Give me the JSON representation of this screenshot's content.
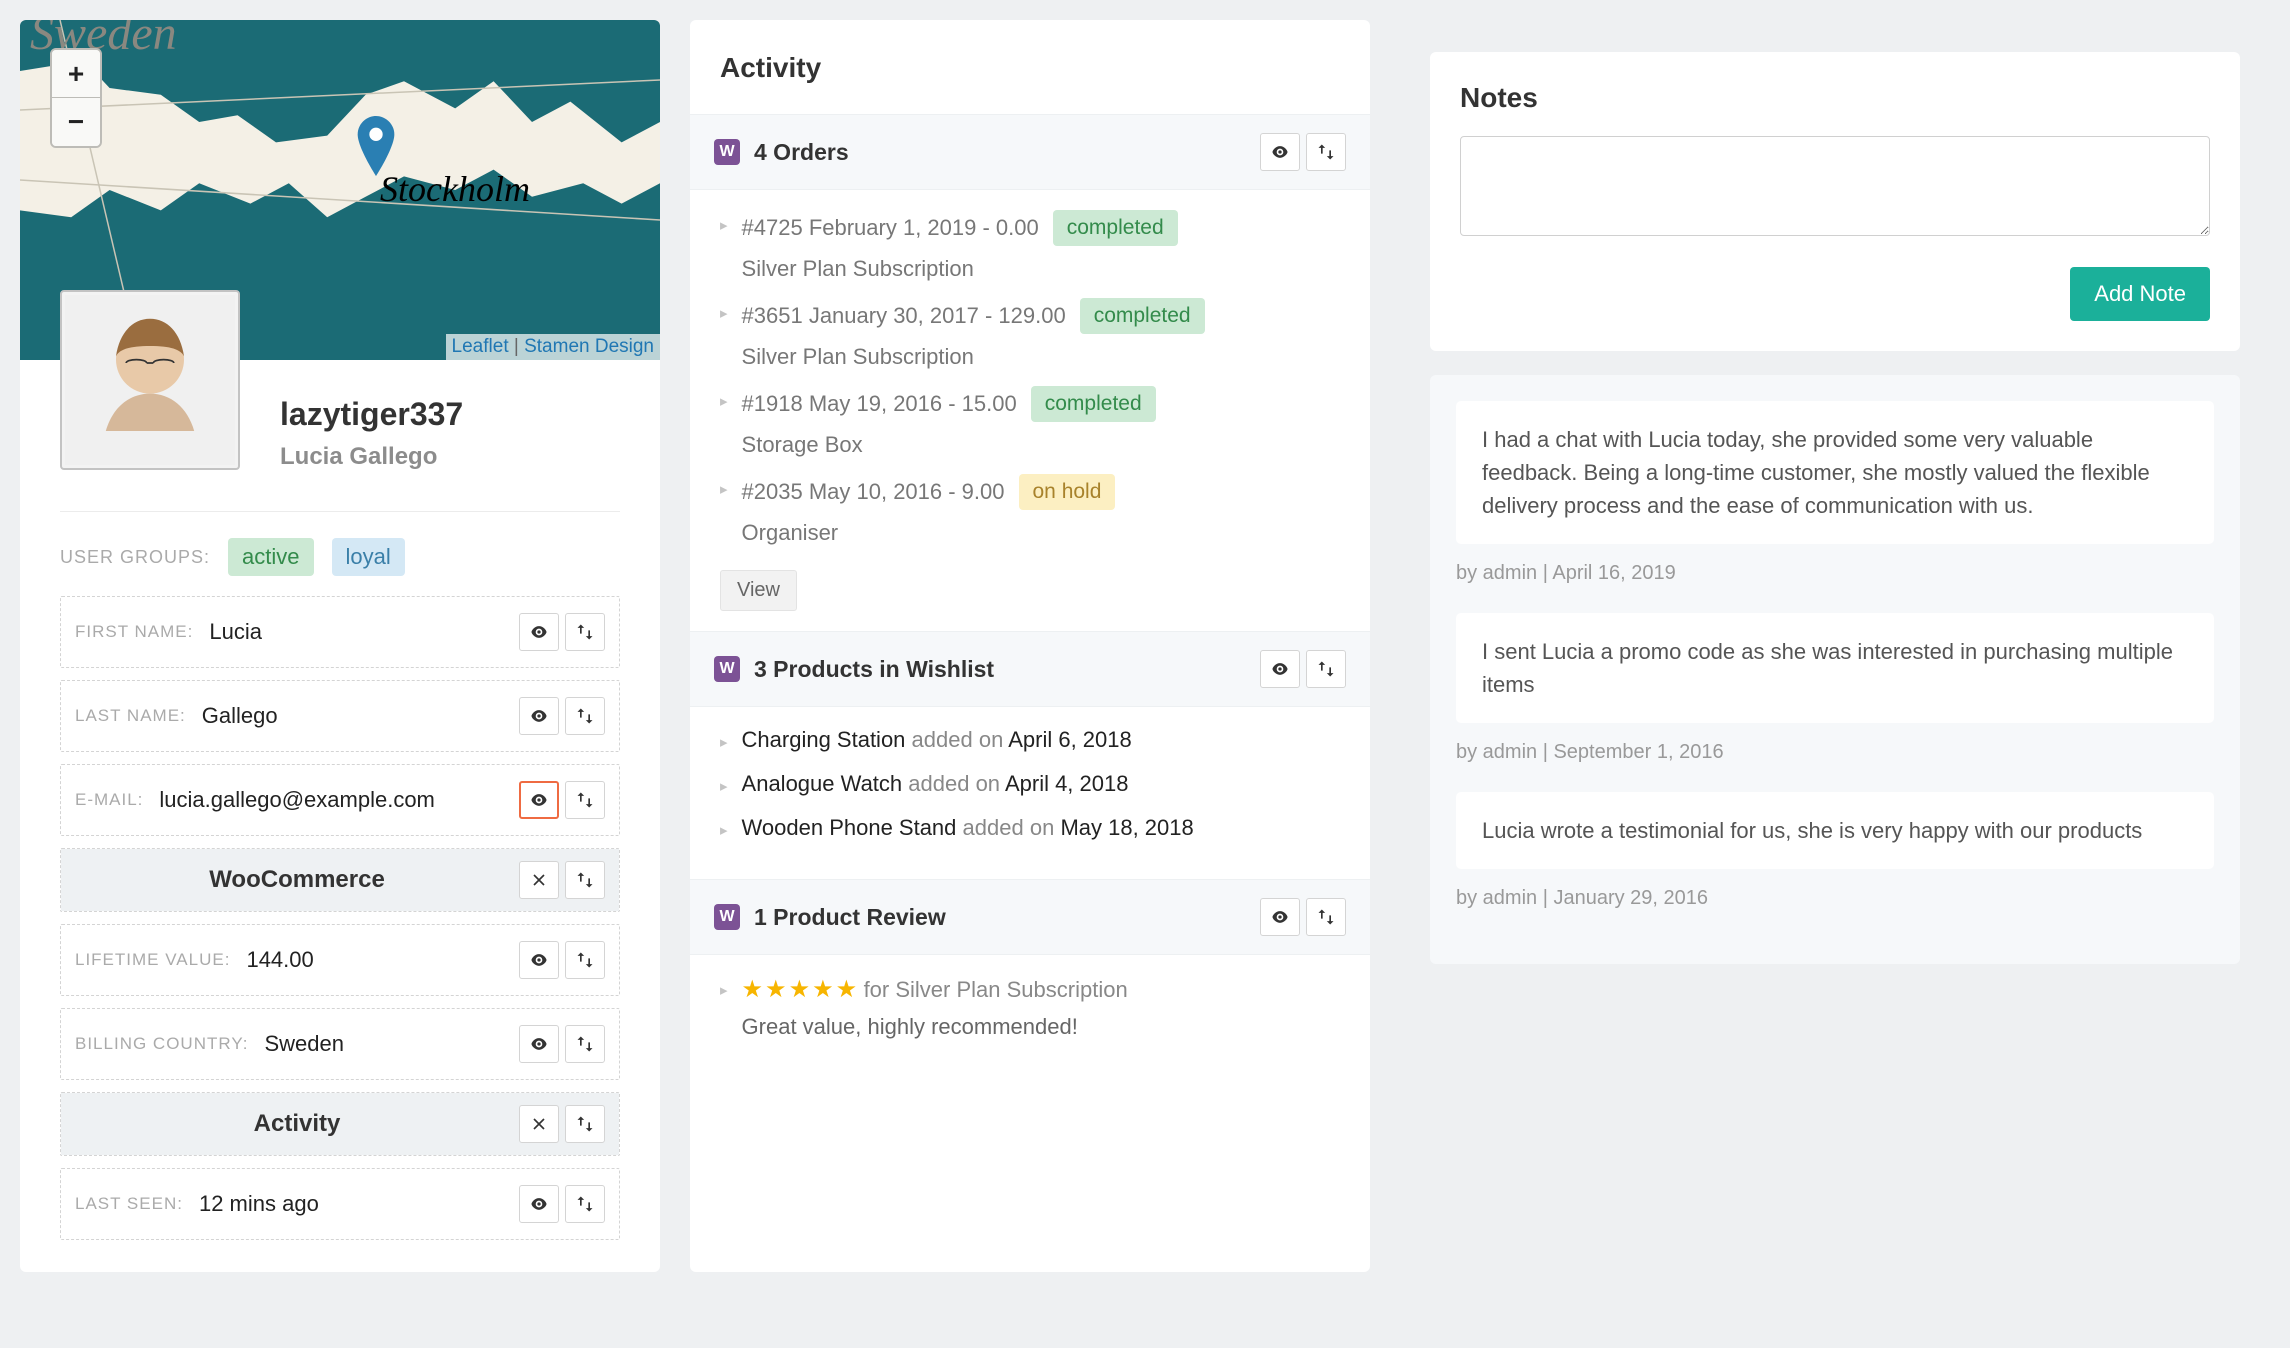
{
  "profile": {
    "map": {
      "country_label": "Sweden",
      "city_label": "Stockholm",
      "zoom_in": "+",
      "zoom_out": "−",
      "attr_leaflet": "Leaflet",
      "attr_sep": " | ",
      "attr_stamen": "Stamen Design"
    },
    "username": "lazytiger337",
    "full_name": "Lucia Gallego",
    "groups_label": "USER GROUPS:",
    "groups": [
      {
        "name": "active",
        "style": "green"
      },
      {
        "name": "loyal",
        "style": "blue"
      }
    ],
    "fields": {
      "first_name": {
        "label": "FIRST NAME:",
        "value": "Lucia"
      },
      "last_name": {
        "label": "LAST NAME:",
        "value": "Gallego"
      },
      "email": {
        "label": "E-MAIL:",
        "value": "lucia.gallego@example.com"
      },
      "lifetime_value": {
        "label": "LIFETIME VALUE:",
        "value": "144.00"
      },
      "billing_country": {
        "label": "BILLING COUNTRY:",
        "value": "Sweden"
      },
      "last_seen": {
        "label": "LAST SEEN:",
        "value": "12 mins ago"
      }
    },
    "sections": {
      "woocommerce": "WooCommerce",
      "activity": "Activity"
    }
  },
  "activity": {
    "heading": "Activity",
    "groups": {
      "orders": {
        "title": "4 Orders",
        "items": [
          {
            "id": "#4725",
            "date": "February 1, 2019",
            "amount": "0.00",
            "status": "completed",
            "status_style": "complete",
            "desc": "Silver Plan Subscription"
          },
          {
            "id": "#3651",
            "date": "January 30, 2017",
            "amount": "129.00",
            "status": "completed",
            "status_style": "complete",
            "desc": "Silver Plan Subscription"
          },
          {
            "id": "#1918",
            "date": "May 19, 2016",
            "amount": "15.00",
            "status": "completed",
            "status_style": "complete",
            "desc": "Storage Box"
          },
          {
            "id": "#2035",
            "date": "May 10, 2016",
            "amount": "9.00",
            "status": "on hold",
            "status_style": "hold",
            "desc": "Organiser"
          }
        ],
        "view_label": "View"
      },
      "wishlist": {
        "title": "3 Products in Wishlist",
        "added_label": "added on",
        "items": [
          {
            "name": "Charging Station",
            "date": "April 6, 2018"
          },
          {
            "name": "Analogue Watch",
            "date": "April 4, 2018"
          },
          {
            "name": "Wooden Phone Stand",
            "date": "May 18, 2018"
          }
        ]
      },
      "reviews": {
        "title": "1 Product Review",
        "items": [
          {
            "stars": "★★★★★",
            "for_label": "for",
            "product": "Silver Plan Subscription",
            "text": "Great value, highly recommended!"
          }
        ]
      }
    }
  },
  "notes": {
    "heading": "Notes",
    "add_button": "Add Note",
    "by_label": "by",
    "items": [
      {
        "text": "I had a chat with Lucia today, she provided some very valuable feedback. Being a long-time customer, she mostly valued the flexible delivery process and the ease of communication with us.",
        "author": "admin",
        "date": "April 16, 2019"
      },
      {
        "text": "I sent Lucia a promo code as she was interested in purchasing multiple items",
        "author": "admin",
        "date": "September 1, 2016"
      },
      {
        "text": "Lucia wrote a testimonial for us, she is very happy with our products",
        "author": "admin",
        "date": "January 29, 2016"
      }
    ]
  }
}
